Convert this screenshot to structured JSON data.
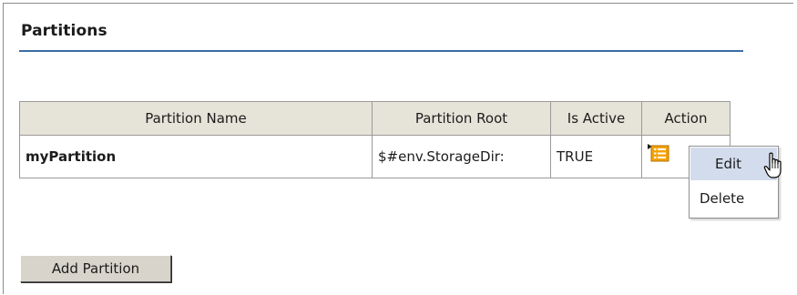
{
  "panel": {
    "title": "Partitions"
  },
  "table": {
    "headers": {
      "name": "Partition Name",
      "root": "Partition Root",
      "active": "Is Active",
      "action": "Action"
    },
    "rows": [
      {
        "name": "myPartition",
        "root": "$#env.StorageDir:",
        "active": "TRUE",
        "action_icon": "action-menu-icon"
      }
    ]
  },
  "context_menu": {
    "items": [
      {
        "label": "Edit",
        "state": "hover"
      },
      {
        "label": "Delete"
      }
    ]
  },
  "buttons": {
    "add_partition": "Add Partition"
  },
  "colors": {
    "title_rule": "#3a6ea5",
    "header_bg": "#e6e3d8",
    "menu_hover": "#d3dcec",
    "icon_orange": "#f5a300"
  },
  "cursor_icon": "hand-pointer-icon"
}
